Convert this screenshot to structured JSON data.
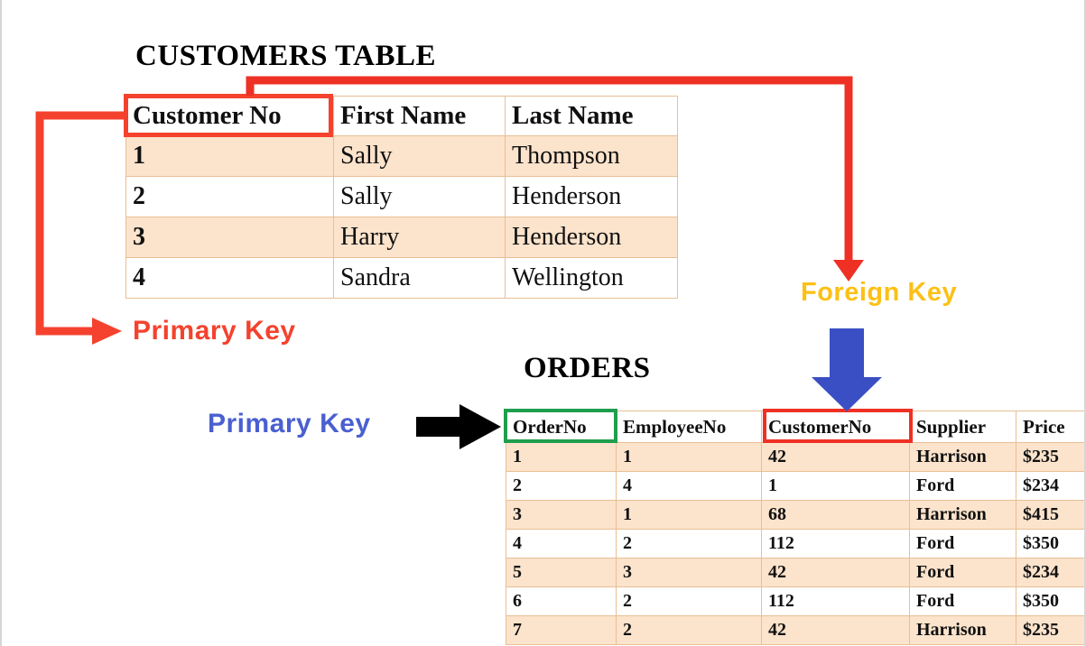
{
  "customers": {
    "title": "CUSTOMERS TABLE",
    "columns": [
      "Customer No",
      "First Name",
      "Last Name"
    ],
    "rows": [
      [
        "1",
        "Sally",
        "Thompson"
      ],
      [
        "2",
        "Sally",
        "Henderson"
      ],
      [
        "3",
        "Harry",
        "Henderson"
      ],
      [
        "4",
        "Sandra",
        "Wellington"
      ]
    ]
  },
  "orders": {
    "title": "ORDERS",
    "columns": [
      "OrderNo",
      "EmployeeNo",
      "CustomerNo",
      "Supplier",
      "Price"
    ],
    "rows": [
      [
        "1",
        "1",
        "42",
        "Harrison",
        "$235"
      ],
      [
        "2",
        "4",
        "1",
        "Ford",
        "$234"
      ],
      [
        "3",
        "1",
        "68",
        "Harrison",
        "$415"
      ],
      [
        "4",
        "2",
        "112",
        "Ford",
        "$350"
      ],
      [
        "5",
        "3",
        "42",
        "Ford",
        "$234"
      ],
      [
        "6",
        "2",
        "112",
        "Ford",
        "$350"
      ],
      [
        "7",
        "2",
        "42",
        "Harrison",
        "$235"
      ]
    ]
  },
  "annotations": {
    "primary_key_customers": "Primary Key",
    "foreign_key": "Foreign Key",
    "primary_key_orders": "Primary Key"
  },
  "colors": {
    "primary_key_red": "#f4422e",
    "foreign_key_gold": "#fcc016",
    "primary_key_blue": "#4a5fd0",
    "orderno_outline_green": "#1f9e4e",
    "customerno_outline_red": "#ee3124",
    "black_arrow": "#000000",
    "blue_arrow": "#3b4fc4",
    "row_fill": "#fce3cc",
    "table_border": "#e8bf94"
  }
}
